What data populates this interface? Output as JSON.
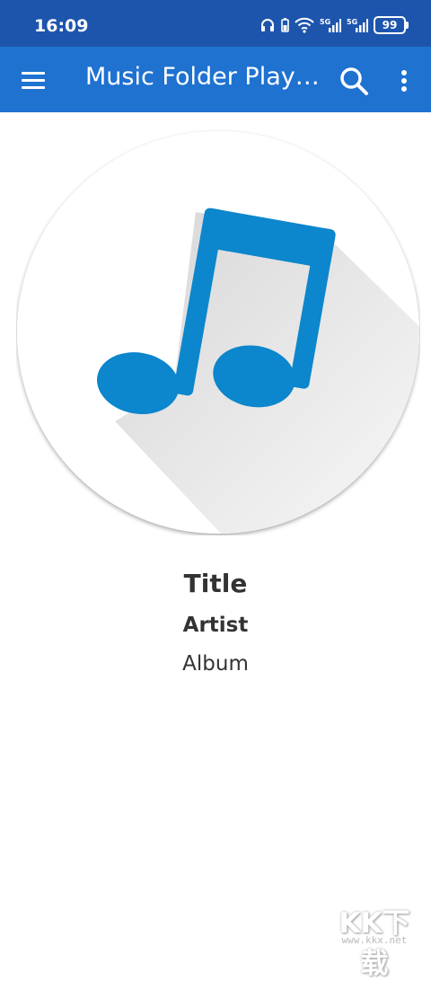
{
  "status_bar": {
    "time": "16:09",
    "battery": "99",
    "icons": [
      "headphones-icon",
      "battery-saver-icon",
      "wifi-icon",
      "signal-5g-icon",
      "signal-5g-icon",
      "battery-icon"
    ]
  },
  "app_bar": {
    "title": "Music Folder Playe...",
    "background": "#1f72d0"
  },
  "album_art": {
    "icon": "music-note-icon",
    "accent": "#0c86cc"
  },
  "track": {
    "title": "Title",
    "artist": "Artist",
    "album": "Album"
  },
  "watermark": {
    "text": "KK下载",
    "url": "www.kkx.net"
  }
}
